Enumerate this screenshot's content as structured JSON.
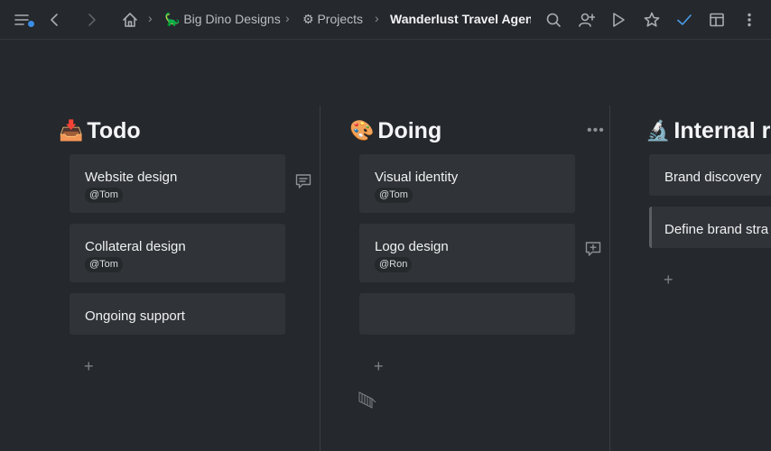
{
  "toolbar": {
    "menu_icon": "menu-icon",
    "back_icon": "chevron-left-icon",
    "forward_icon": "chevron-right-icon",
    "home_icon": "home-icon",
    "breadcrumbs": [
      {
        "emoji": "🦕",
        "label": "Big Dino Designs"
      },
      {
        "emoji": "⚙",
        "label": "Projects"
      },
      {
        "emoji": "",
        "label": "Wanderlust Travel Agency"
      }
    ],
    "actions": [
      "search-icon",
      "add-user-icon",
      "play-icon",
      "star-icon",
      "check-icon",
      "layout-icon",
      "more-vertical-icon"
    ],
    "accent_color": "#3b8ee6"
  },
  "columns": [
    {
      "emoji": "📥",
      "title": "Todo",
      "cards": [
        {
          "title": "Website design",
          "tag": "@Tom"
        },
        {
          "title": "Collateral design",
          "tag": "@Tom"
        },
        {
          "title": "Ongoing support",
          "tag": ""
        }
      ],
      "add_label": "+"
    },
    {
      "emoji": "🎨",
      "title": "Doing",
      "cards": [
        {
          "title": "Visual identity",
          "tag": "@Tom"
        },
        {
          "title": "Logo design",
          "tag": "@Ron"
        },
        {
          "title": "",
          "tag": ""
        }
      ],
      "add_label": "+"
    },
    {
      "emoji": "🔬",
      "title": "Internal r",
      "cards": [
        {
          "title": "Brand discovery",
          "tag": ""
        },
        {
          "title": "Define brand stra",
          "tag": ""
        }
      ],
      "add_label": "+"
    }
  ]
}
